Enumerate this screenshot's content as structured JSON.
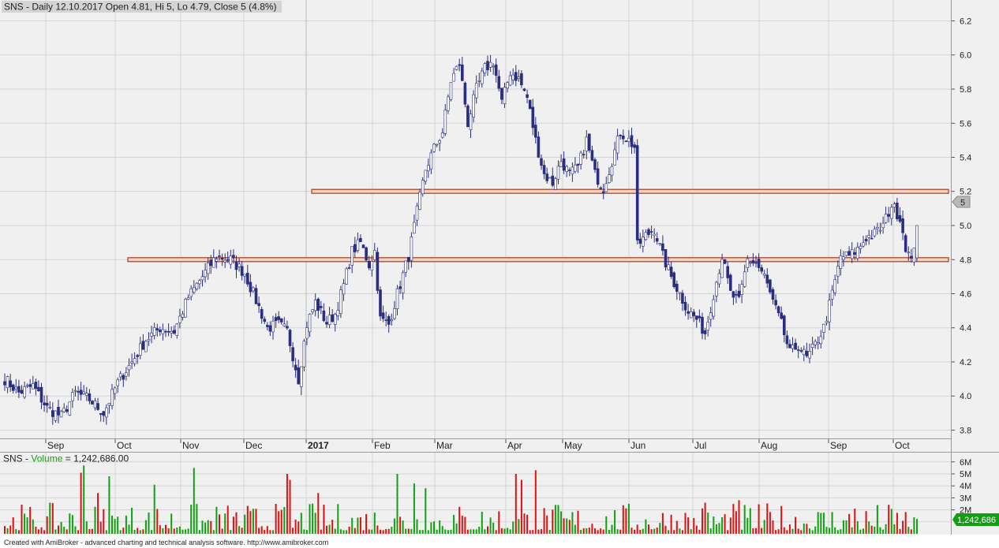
{
  "price_pane": {
    "title": "SNS - Daily 12.10.2017 Open 4.81, Hi 5, Lo 4.79, Close 5 (4.8%)",
    "last_value_label": "5"
  },
  "volume_pane": {
    "title_symbol": "SNS",
    "title_sep": " - ",
    "title_name": "Volume",
    "title_eq": " = ",
    "title_value": "1,242,686.00",
    "last_value_label": "1,242,686"
  },
  "footer": {
    "credit": "Created with AmiBroker - advanced charting and technical analysis software. http://www.amibroker.com"
  },
  "colors": {
    "background": "#f0f0f0",
    "grid": "#d4d4d4",
    "up_candle": "#ffffff",
    "down_candle": "#2a2e80",
    "support_line": "#a04020",
    "volume_up": "#11a011",
    "volume_down": "#dd1111"
  },
  "chart_data": [
    {
      "type": "candlestick",
      "symbol": "SNS",
      "period": "Daily",
      "last_bar": {
        "date": "12.10.2017",
        "open": 4.81,
        "high": 5,
        "low": 4.79,
        "close": 5,
        "change_pct": 4.8
      },
      "y_ticks": [
        "3.8",
        "4.0",
        "4.2",
        "4.4",
        "4.6",
        "4.8",
        "5.0",
        "5.2",
        "5.4",
        "5.6",
        "5.8",
        "6.0",
        "6.2"
      ],
      "ylim": [
        3.8,
        6.2
      ],
      "x_ticks": [
        "Sep",
        "Oct",
        "Nov",
        "Dec",
        "2017",
        "Feb",
        "Mar",
        "Apr",
        "May",
        "Jun",
        "Jul",
        "Aug",
        "Sep",
        "Oct"
      ],
      "horizontal_lines": [
        4.8,
        5.2
      ],
      "grid": true,
      "close_path": [
        [
          0,
          4.1
        ],
        [
          5,
          4.02
        ],
        [
          10,
          4.06
        ],
        [
          15,
          3.93
        ],
        [
          20,
          3.88
        ],
        [
          25,
          4.02
        ],
        [
          30,
          3.98
        ],
        [
          35,
          3.9
        ],
        [
          40,
          4.08
        ],
        [
          45,
          4.2
        ],
        [
          50,
          4.33
        ],
        [
          55,
          4.4
        ],
        [
          60,
          4.38
        ],
        [
          65,
          4.58
        ],
        [
          70,
          4.7
        ],
        [
          75,
          4.82
        ],
        [
          80,
          4.8
        ],
        [
          85,
          4.72
        ],
        [
          90,
          4.52
        ],
        [
          93,
          4.4
        ],
        [
          97,
          4.42
        ],
        [
          100,
          4.38
        ],
        [
          104,
          4.1
        ],
        [
          107,
          4.42
        ],
        [
          110,
          4.55
        ],
        [
          114,
          4.43
        ],
        [
          117,
          4.48
        ],
        [
          120,
          4.65
        ],
        [
          123,
          4.85
        ],
        [
          126,
          4.9
        ],
        [
          129,
          4.77
        ],
        [
          131,
          4.85
        ],
        [
          133,
          4.45
        ],
        [
          136,
          4.42
        ],
        [
          139,
          4.6
        ],
        [
          143,
          4.82
        ],
        [
          146,
          5.08
        ],
        [
          149,
          5.33
        ],
        [
          152,
          5.45
        ],
        [
          155,
          5.55
        ],
        [
          158,
          5.85
        ],
        [
          161,
          5.95
        ],
        [
          164,
          5.6
        ],
        [
          167,
          5.8
        ],
        [
          170,
          5.92
        ],
        [
          173,
          5.96
        ],
        [
          176,
          5.72
        ],
        [
          179,
          5.9
        ],
        [
          182,
          5.86
        ],
        [
          185,
          5.75
        ],
        [
          188,
          5.5
        ],
        [
          191,
          5.3
        ],
        [
          194,
          5.25
        ],
        [
          197,
          5.38
        ],
        [
          200,
          5.3
        ],
        [
          203,
          5.34
        ],
        [
          206,
          5.5
        ],
        [
          209,
          5.3
        ],
        [
          212,
          5.22
        ],
        [
          215,
          5.38
        ],
        [
          218,
          5.55
        ],
        [
          221,
          5.5
        ],
        [
          223,
          5.46
        ],
        [
          224,
          4.88
        ],
        [
          227,
          4.94
        ],
        [
          230,
          4.98
        ],
        [
          233,
          4.82
        ],
        [
          236,
          4.7
        ],
        [
          239,
          4.6
        ],
        [
          242,
          4.5
        ],
        [
          245,
          4.45
        ],
        [
          248,
          4.37
        ],
        [
          251,
          4.6
        ],
        [
          254,
          4.82
        ],
        [
          257,
          4.6
        ],
        [
          260,
          4.55
        ],
        [
          263,
          4.8
        ],
        [
          266,
          4.78
        ],
        [
          269,
          4.7
        ],
        [
          272,
          4.55
        ],
        [
          275,
          4.42
        ],
        [
          278,
          4.25
        ],
        [
          281,
          4.3
        ],
        [
          284,
          4.22
        ],
        [
          287,
          4.3
        ],
        [
          290,
          4.4
        ],
        [
          293,
          4.6
        ],
        [
          296,
          4.82
        ],
        [
          299,
          4.82
        ],
        [
          302,
          4.86
        ],
        [
          305,
          4.93
        ],
        [
          308,
          4.95
        ],
        [
          311,
          5.0
        ],
        [
          314,
          5.12
        ],
        [
          317,
          5.05
        ],
        [
          319,
          4.88
        ],
        [
          321,
          4.78
        ],
        [
          323,
          5.0
        ]
      ]
    },
    {
      "type": "bar",
      "name": "Volume",
      "y_ticks": [
        "2M",
        "3M",
        "4M",
        "5M",
        "6M"
      ],
      "ylim": [
        0,
        6000000
      ],
      "last_value": 1242686,
      "peaks_millions": [
        [
          10,
          1.2
        ],
        [
          27,
          5.1
        ],
        [
          28,
          5.7
        ],
        [
          33,
          3.4
        ],
        [
          37,
          4.8
        ],
        [
          53,
          4.1
        ],
        [
          67,
          5.5
        ],
        [
          100,
          5.0
        ],
        [
          101,
          4.5
        ],
        [
          111,
          3.4
        ],
        [
          139,
          5.0
        ],
        [
          145,
          4.2
        ],
        [
          149,
          3.8
        ],
        [
          181,
          5.0
        ],
        [
          183,
          4.5
        ],
        [
          188,
          5.3
        ],
        [
          248,
          2.6
        ],
        [
          260,
          2.8
        ],
        [
          301,
          2.1
        ]
      ]
    }
  ]
}
